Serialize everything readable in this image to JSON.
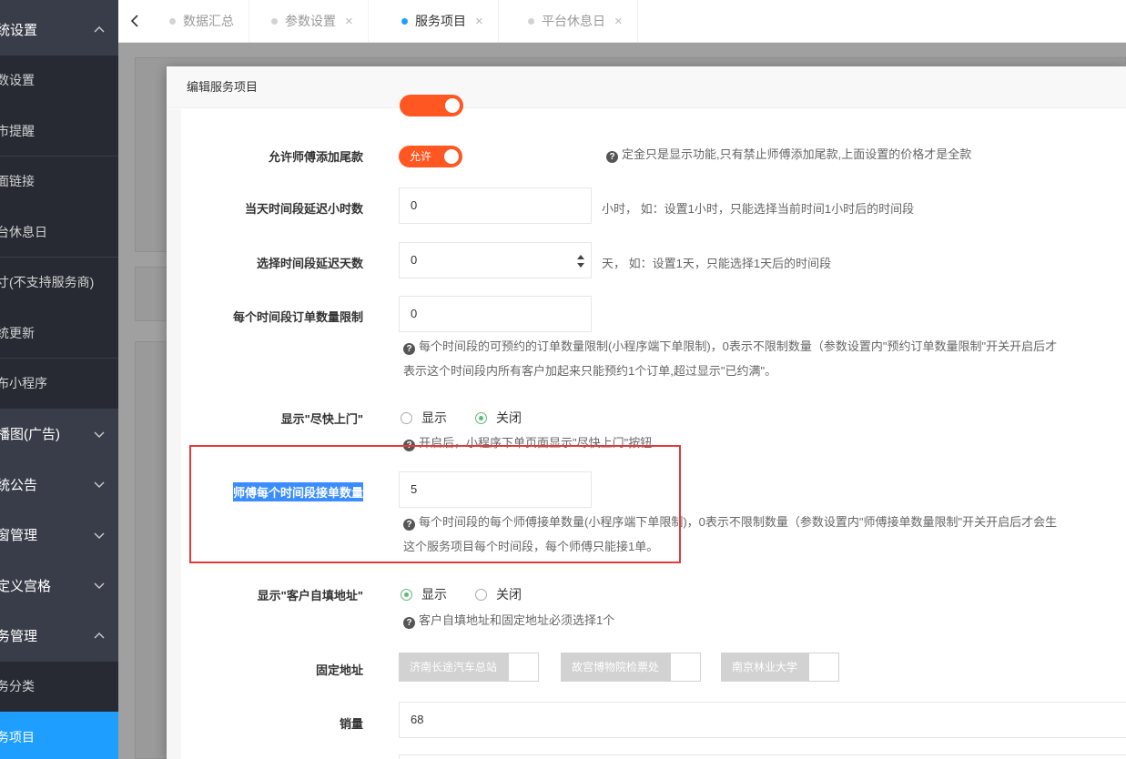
{
  "sidebar": {
    "items": [
      {
        "label": "统设置",
        "kind": "group",
        "arrow": "up"
      },
      {
        "label": "数设置",
        "kind": "child"
      },
      {
        "label": "市提醒",
        "kind": "child"
      },
      {
        "label": "面链接",
        "kind": "child"
      },
      {
        "label": "台休息日",
        "kind": "child"
      },
      {
        "label": "寸(不支持服务商)",
        "kind": "child"
      },
      {
        "label": "统更新",
        "kind": "child"
      },
      {
        "label": "布小程序",
        "kind": "child"
      },
      {
        "label": "播图(广告)",
        "kind": "group",
        "arrow": "down"
      },
      {
        "label": "统公告",
        "kind": "group",
        "arrow": "down"
      },
      {
        "label": "窗管理",
        "kind": "group",
        "arrow": "down"
      },
      {
        "label": "定义宫格",
        "kind": "group",
        "arrow": "down"
      },
      {
        "label": "务管理",
        "kind": "group",
        "arrow": "up"
      },
      {
        "label": "务分类",
        "kind": "child"
      },
      {
        "label": "务项目",
        "kind": "child",
        "active": true
      }
    ]
  },
  "tabs": [
    {
      "label": "数据汇总",
      "closable": false,
      "active": false
    },
    {
      "label": "参数设置",
      "closable": true,
      "active": false
    },
    {
      "label": "服务项目",
      "closable": true,
      "active": true
    },
    {
      "label": "平台休息日",
      "closable": true,
      "active": false
    }
  ],
  "tab_close_glyph": "×",
  "dialog": {
    "title": "编辑服务项目",
    "fields": {
      "allow_tail": {
        "label": "允许师傅添加尾款",
        "switch_label": "允许",
        "tip": "定金只是显示功能,只有禁止师傅添加尾款,上面设置的价格才是全款"
      },
      "delay_hours": {
        "label": "当天时间段延迟小时数",
        "value": "0",
        "aside": "小时，  如：设置1小时，只能选择当前时间1小时后的时间段"
      },
      "delay_days": {
        "label": "选择时间段延迟天数",
        "value": "0",
        "aside": "天，  如：设置1天，只能选择1天后的时间段"
      },
      "order_limit": {
        "label": "每个时间段订单数量限制",
        "value": "0",
        "tip1": "每个时间段的可预约的订单数量限制(小程序端下单限制)，0表示不限制数量（参数设置内\"预约订单数量限制\"开关开启后才",
        "tip2": "表示这个时间段内所有客户加起来只能预约1个订单,超过显示\"已约满\"。"
      },
      "show_asap": {
        "label": "显示\"尽快上门\"",
        "options": [
          "显示",
          "关闭"
        ],
        "selected": "关闭",
        "tip": "开启后，小程序下单页面显示\"尽快上门\"按钮"
      },
      "master_limit": {
        "label": "师傅每个时间段接单数量",
        "value": "5",
        "tip1": "每个时间段的每个师傅接单数量(小程序端下单限制)，0表示不限制数量（参数设置内\"师傅接单数量限制\"开关开启后才会生",
        "tip2": "这个服务项目每个时间段，每个师傅只能接1单。"
      },
      "show_custom_addr": {
        "label": "显示\"客户自填地址\"",
        "options": [
          "显示",
          "关闭"
        ],
        "selected": "显示",
        "tip": "客户自填地址和固定地址必须选择1个"
      },
      "fixed_addr": {
        "label": "固定地址",
        "options": [
          "济南长途汽车总站",
          "故宫博物院检票处",
          "南京林业大学"
        ]
      },
      "sales": {
        "label": "销量",
        "value": "68"
      }
    }
  },
  "colors": {
    "sidebar_bg": "#393d49",
    "sidebar_child_bg": "#272a33",
    "active_blue": "#1e9fff",
    "switch_orange": "#ff5722",
    "radio_green": "#5fb878",
    "highlight_box": "#e03a3a",
    "selection_blue": "#3a8cff"
  }
}
